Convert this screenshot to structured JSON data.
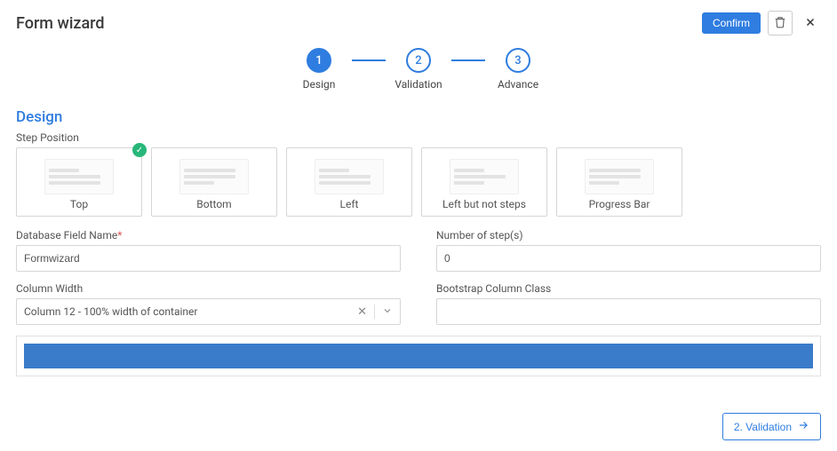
{
  "header": {
    "title": "Form wizard",
    "confirm_label": "Confirm"
  },
  "stepper": {
    "steps": [
      {
        "num": "1",
        "label": "Design",
        "active": true
      },
      {
        "num": "2",
        "label": "Validation",
        "active": false
      },
      {
        "num": "3",
        "label": "Advance",
        "active": false
      }
    ]
  },
  "section": {
    "title": "Design"
  },
  "step_position": {
    "label": "Step Position",
    "options": [
      {
        "label": "Top",
        "selected": true
      },
      {
        "label": "Bottom",
        "selected": false
      },
      {
        "label": "Left",
        "selected": false
      },
      {
        "label": "Left but not steps",
        "selected": false
      },
      {
        "label": "Progress Bar",
        "selected": false
      }
    ]
  },
  "fields": {
    "db_name": {
      "label": "Database Field Name",
      "required": true,
      "value": "Formwizard"
    },
    "num_steps": {
      "label": "Number of step(s)",
      "value": "0"
    },
    "col_width": {
      "label": "Column Width",
      "value": "Column 12 - 100% width of container"
    },
    "bs_class": {
      "label": "Bootstrap Column Class",
      "value": ""
    }
  },
  "footer": {
    "next_label": "2. Validation"
  }
}
